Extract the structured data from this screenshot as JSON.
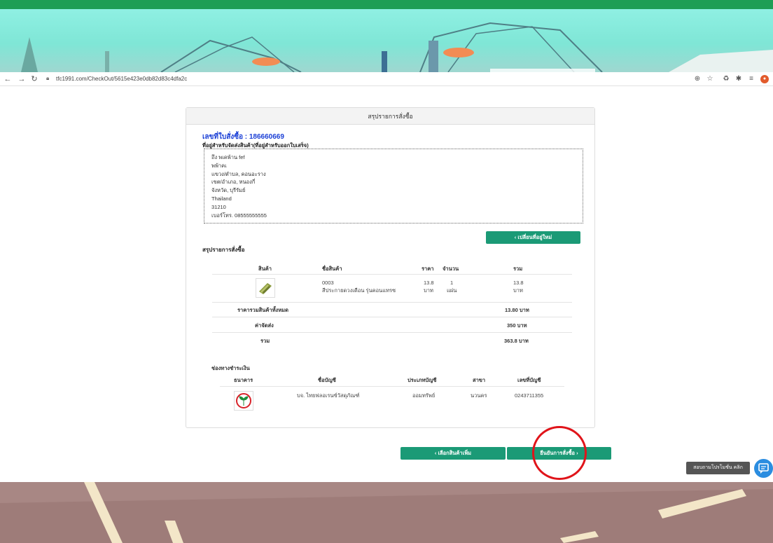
{
  "browser": {
    "url": "tfc1991.com/CheckOut/5615e423e0db82d83c4dfa2c"
  },
  "card": {
    "header_title": "สรุปรายการสั่งซื้อ",
    "order_number": "เลขที่ใบสั่งซื้อ : 186660669",
    "address_label": "ที่อยู่สำหรับจัดส่งสินค้า(ที่อยู่สำหรับออกใบเสร็จ)",
    "address_lines": [
      "ถึง พเคพ้าน fef",
      "พพ้าคเ",
      "แขวง/ตำบล, คอนอะราง",
      "เขต/อำเภอ, หนองกี่",
      "จังหวัด, บุรีรัมย์",
      "Thailand",
      "31210",
      "เบอร์โทร. 08555555555"
    ],
    "change_address_button": "‹ เปลี่ยนที่อยู่ใหม่",
    "summary_title": "สรุปรายการสั่งซื้อ",
    "items_table": {
      "headers": [
        "สินค้า",
        "ชื่อสินค้า",
        "ราคา",
        "จำนวน",
        "รวม"
      ],
      "rows": [
        {
          "name_code": "0003",
          "name_desc": "สีประกายดวงเดือน รุ่นคอนแทรซ",
          "price": "13.8",
          "price_unit": "บาท",
          "qty": "1",
          "qty_unit": "แผ่น",
          "total": "13.8",
          "total_unit": "บาท"
        }
      ]
    },
    "totals": {
      "subtotal_label": "ราคารวมสินค้าทั้งหมด",
      "subtotal_value": "13.80 บาท",
      "shipping_label": "ค่าจัดส่ง",
      "shipping_value": "350 บาท",
      "grand_label": "รวม",
      "grand_value": "363.8 บาท"
    },
    "payment": {
      "title": "ช่องทางชำระเงิน",
      "headers": [
        "ธนาคาร",
        "ชื่อบัญชี",
        "ประเภทบัญชี",
        "สาขา",
        "เลขที่บัญชี"
      ],
      "rows": [
        {
          "account_name": "บจ. ไทยฟลอเรนซ์วัสดุภัณฑ์",
          "account_type": "ออมทรัพย์",
          "branch": "นวนคร",
          "account_number": "0243711355"
        }
      ]
    }
  },
  "actions": {
    "more_products": "‹ เลือกสินค้าเพิ่ม",
    "confirm_order": "ยืนยันการสั่งซื้อ ›"
  },
  "chat": {
    "tooltip": "สอบถามโปรโมชั่น คลิก"
  },
  "colors": {
    "accent_green": "#1b9a76",
    "top_bar": "#1e9e55",
    "order_number_blue": "#1a3fd6",
    "highlight_red": "#e0141a",
    "chat_blue": "#2b8de0"
  }
}
